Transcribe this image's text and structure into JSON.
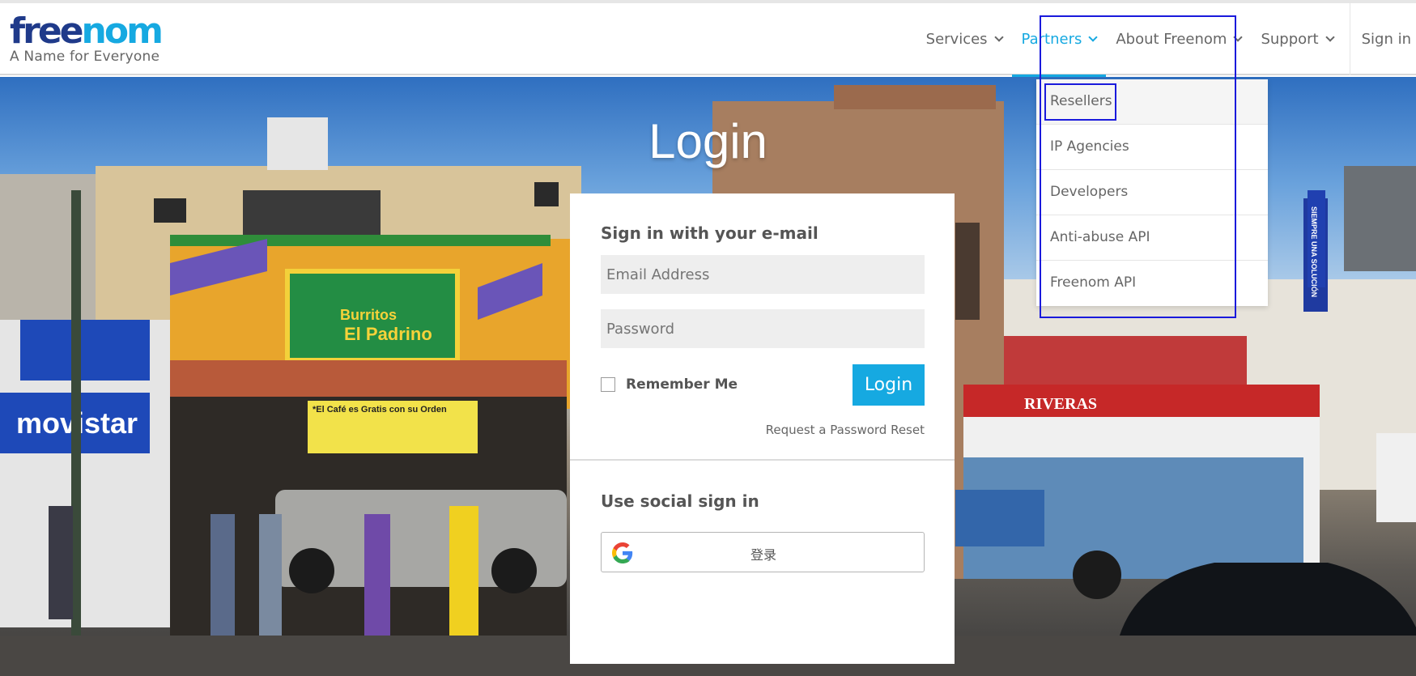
{
  "brand": {
    "logo_free": "free",
    "logo_nom": "nom",
    "tagline": "A Name for Everyone",
    "primary_color": "#16a9e1",
    "dark_color": "#1f3a8a"
  },
  "nav": {
    "items": [
      {
        "label": "Services",
        "active": false
      },
      {
        "label": "Partners",
        "active": true
      },
      {
        "label": "About Freenom",
        "active": false
      },
      {
        "label": "Support",
        "active": false
      }
    ],
    "signin": "Sign in"
  },
  "partners_menu": {
    "items": [
      "Resellers",
      "IP Agencies",
      "Developers",
      "Anti-abuse API",
      "Freenom API"
    ]
  },
  "hero": {
    "title": "Login",
    "sign_burritos": "Burritos",
    "sign_padrino": "El Padrino",
    "sign_movistar": "movistar",
    "sign_riveras": "RIVERAS",
    "sign_solucion": "SIEMPRE UNA SOLUCIÓN",
    "sign_cafe": "*El Café es Gratis con su Orden"
  },
  "login": {
    "email_heading": "Sign in with your e-mail",
    "email_placeholder": "Email Address",
    "password_placeholder": "Password",
    "remember_label": "Remember Me",
    "login_button": "Login",
    "reset_link": "Request a Password Reset",
    "social_heading": "Use social sign in",
    "google_label": "登录"
  }
}
